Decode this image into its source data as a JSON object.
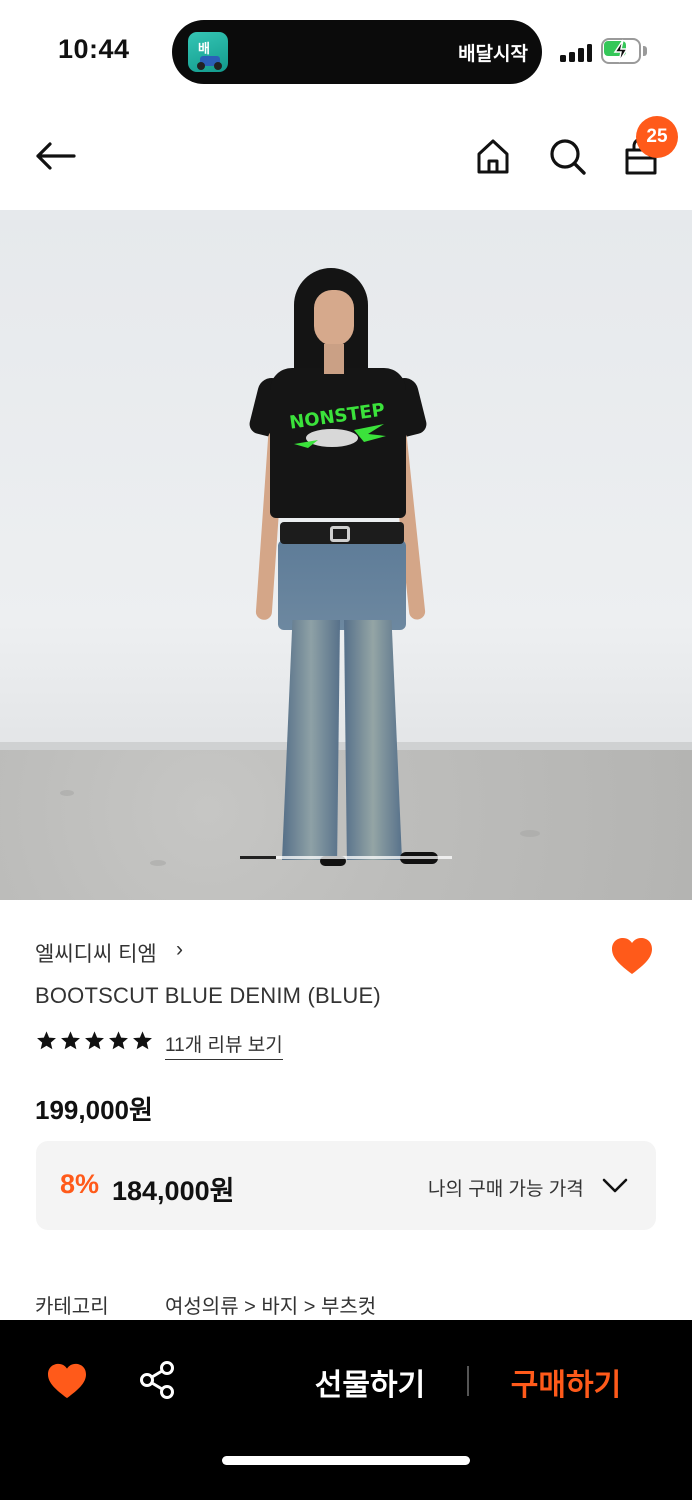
{
  "status_bar": {
    "time": "10:44",
    "live_activity_app_icon_text": "배",
    "live_activity_text": "배달시작",
    "signal_icon": "cellular-signal-icon",
    "battery_icon": "battery-charging-icon",
    "battery_color": "#35c759"
  },
  "header": {
    "back_icon": "arrow-left-icon",
    "home_icon": "home-icon",
    "search_icon": "search-icon",
    "cart_icon": "shopping-bag-icon",
    "cart_count": "25",
    "badge_color": "#ff5a1a"
  },
  "hero": {
    "print_text": "NONSTEP",
    "image_count_indicator": "page-indicator"
  },
  "product": {
    "brand": "엘씨디씨 티엠",
    "brand_chevron": "›",
    "name": "BOOTSCUT BLUE DENIM (BLUE)",
    "rating_stars": 5,
    "review_link": "11개 리뷰 보기",
    "original_price": "199,000원",
    "discount_rate": "8%",
    "discount_price": "184,000원",
    "my_price_label": "나의 구매 가능 가격",
    "category_label": "카테고리",
    "category_path": "여성의류 > 바지 > 부츠컷",
    "accent_color": "#ff5a1a"
  },
  "bottom_bar": {
    "wishlist_icon": "heart-icon",
    "share_icon": "share-icon",
    "gift_label": "선물하기",
    "buy_label": "구매하기"
  }
}
